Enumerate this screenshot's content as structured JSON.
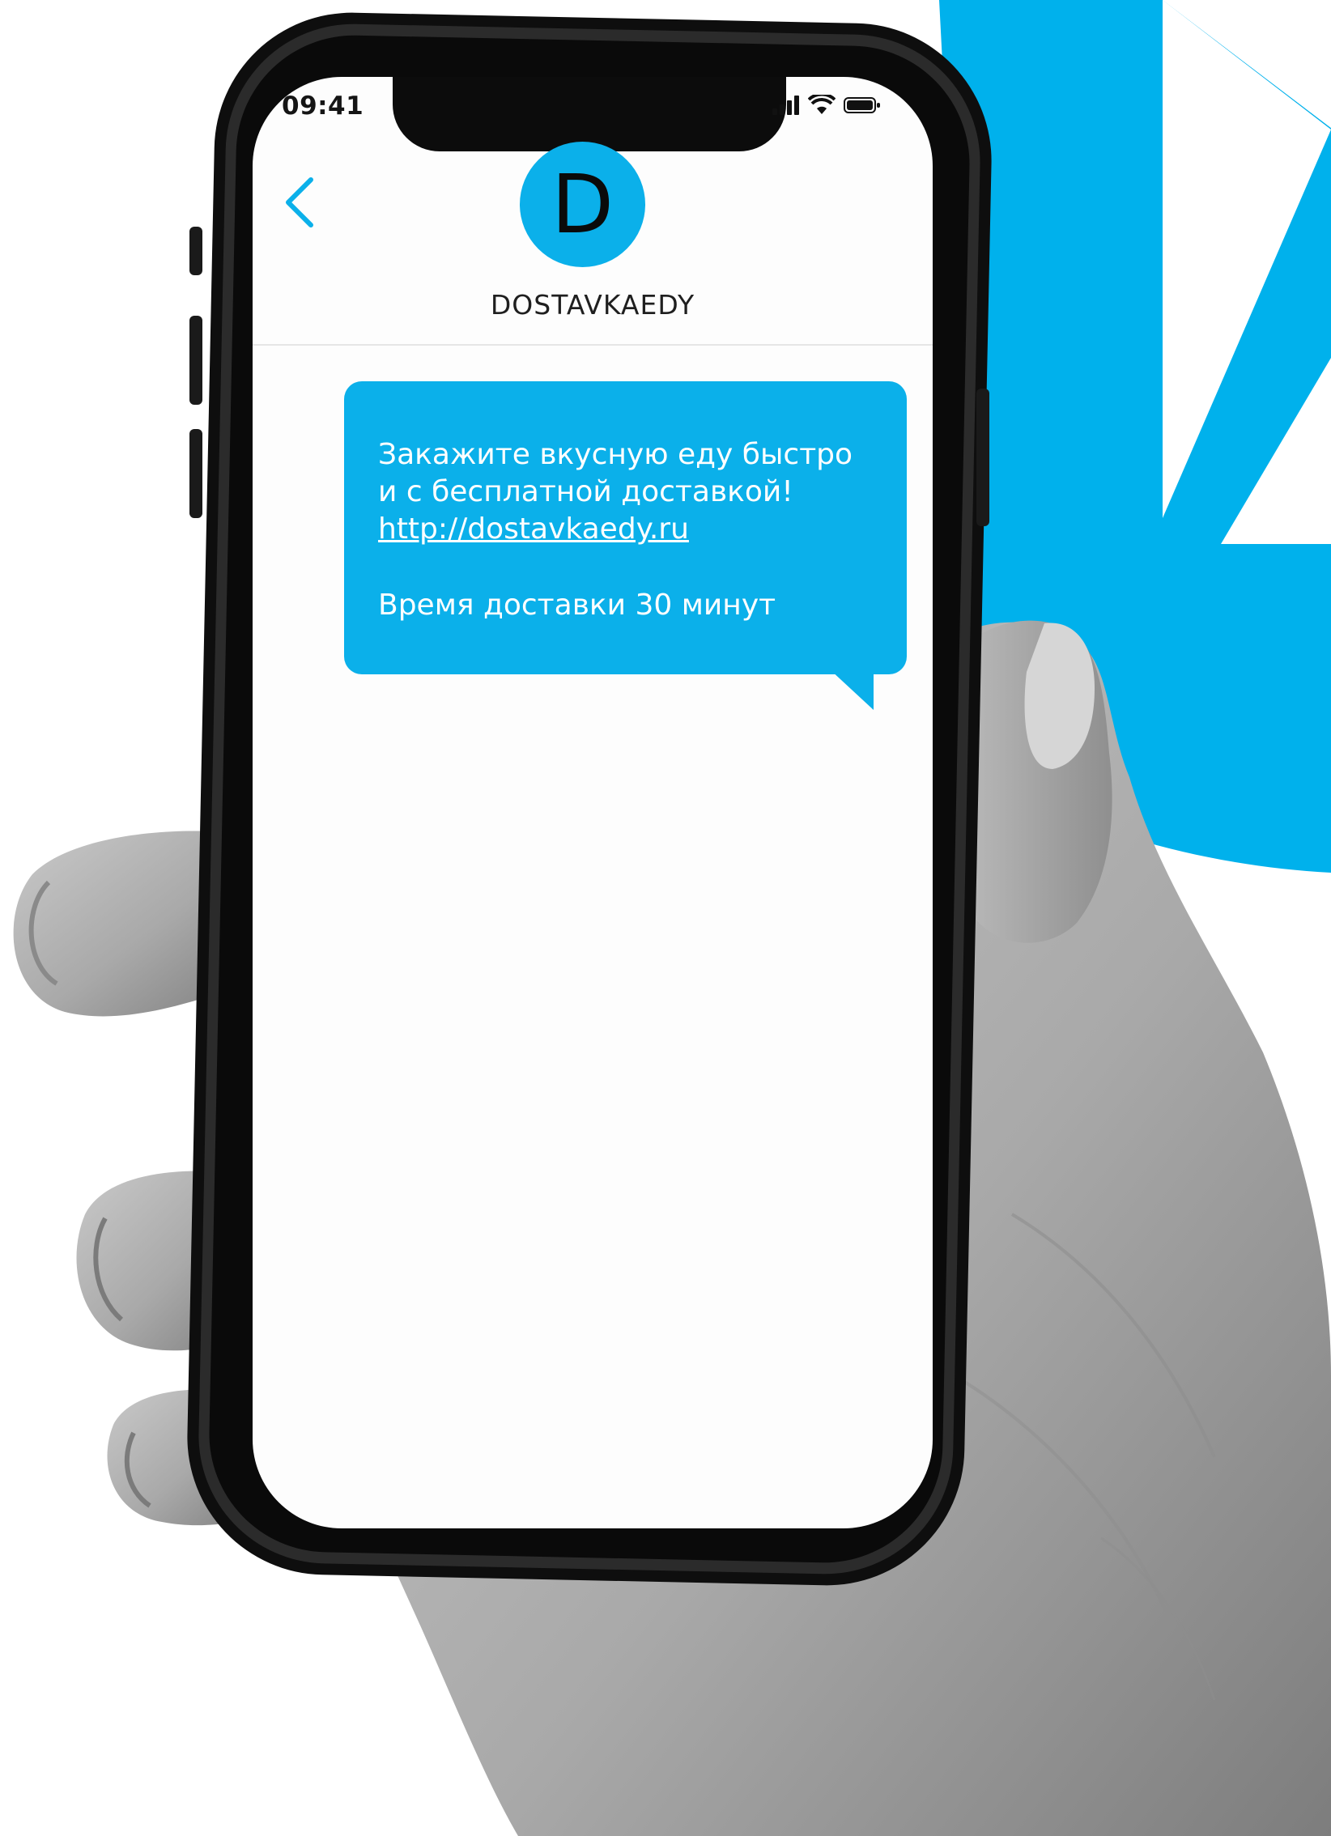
{
  "status_bar": {
    "time": "09:41",
    "signal_icon": "signal-bars-icon",
    "wifi_icon": "wifi-icon",
    "battery_icon": "battery-icon"
  },
  "header": {
    "back_icon": "chevron-left-icon",
    "avatar_letter": "D",
    "contact_name": "DOSTAVKAEDY"
  },
  "message": {
    "lines": [
      "Закажите вкусную еду быстро",
      "и с бесплатной доставкой!"
    ],
    "link": "http://dostavkaedy.ru",
    "footer": "Время доставки 30 минут"
  },
  "colors": {
    "accent": "#0bb0ea",
    "background_shape": "#00b1ec",
    "bubble_text": "#ffffff",
    "screen_bg": "#fdfdfd",
    "phone_frame": "#121212"
  }
}
